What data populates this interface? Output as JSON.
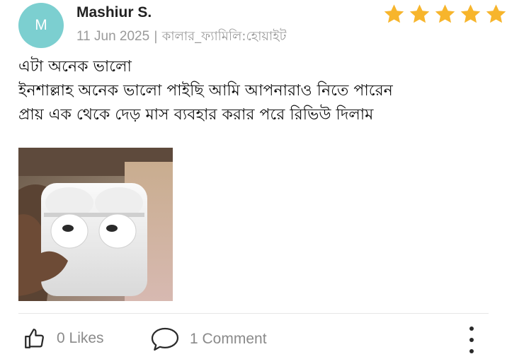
{
  "reviewer": {
    "initial": "M",
    "name": "Mashiur S.",
    "date": "11 Jun 2025",
    "separator": "|",
    "variant": "কালার_ফ্যামিলি:হোয়াইট",
    "avatar_color": "#7ccfd0"
  },
  "rating": {
    "value": 5,
    "max": 5,
    "star_color": "#f7b52c"
  },
  "review": {
    "lines": [
      "এটা অনেক ভালো",
      "ইনশাল্লাহ অনেক ভালো পাইছি আমি আপনারাও নিতে পারেন",
      "প্রায় এক থেকে দেড় মাস ব্যবহার করার পরে রিভিউ দিলাম"
    ]
  },
  "photos": [
    {
      "icon": "product-photo-earbuds"
    }
  ],
  "actions": {
    "likes_label": "0 Likes",
    "comments_label": "1 Comment",
    "like_icon": "thumbs-up-icon",
    "comment_icon": "speech-bubble-icon",
    "more_icon": "more-vertical-icon"
  }
}
